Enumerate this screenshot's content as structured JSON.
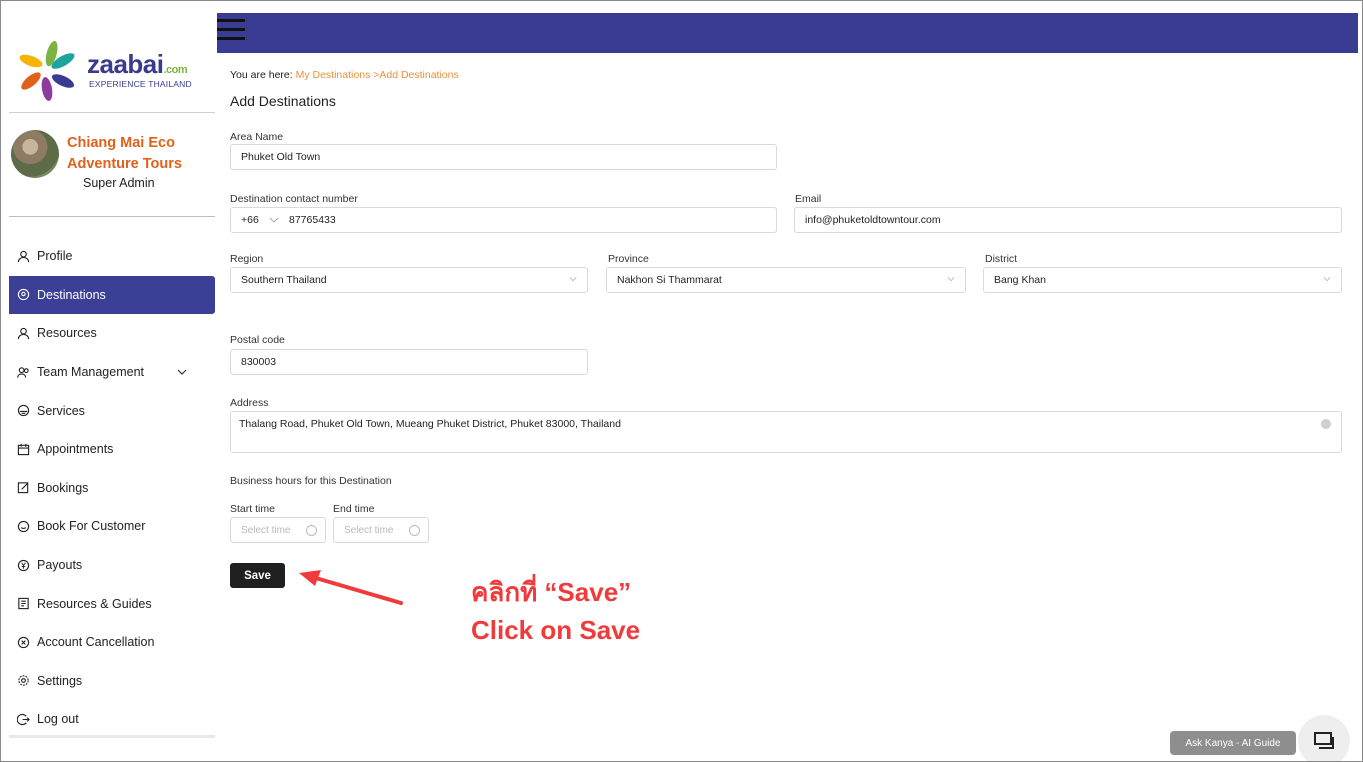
{
  "brand": {
    "name": "zaabai",
    "suffix": ".com",
    "tagline": "EXPERIENCE THAILAND"
  },
  "org": {
    "name": "Chiang Mai Eco Adventure Tours",
    "role": "Super Admin"
  },
  "nav": {
    "items": [
      {
        "label": "Profile",
        "icon": "user-icon"
      },
      {
        "label": "Destinations",
        "icon": "location-icon",
        "active": true
      },
      {
        "label": "Resources",
        "icon": "user-icon"
      },
      {
        "label": "Team Management",
        "icon": "team-icon",
        "expandable": true
      },
      {
        "label": "Services",
        "icon": "services-icon"
      },
      {
        "label": "Appointments",
        "icon": "calendar-icon"
      },
      {
        "label": "Bookings",
        "icon": "edit-icon"
      },
      {
        "label": "Book For Customer",
        "icon": "smile-icon"
      },
      {
        "label": "Payouts",
        "icon": "currency-icon"
      },
      {
        "label": "Resources & Guides",
        "icon": "document-icon"
      },
      {
        "label": "Account Cancellation",
        "icon": "close-circle-icon"
      },
      {
        "label": "Settings",
        "icon": "settings-icon"
      },
      {
        "label": "Log out",
        "icon": "logout-icon"
      }
    ]
  },
  "breadcrumb": {
    "prefix": "You are here:",
    "items": [
      "My Destinations",
      "Add Destinations"
    ],
    "separator": ">"
  },
  "page": {
    "title": "Add Destinations"
  },
  "form": {
    "area_name": {
      "label": "Area Name",
      "value": "Phuket Old Town"
    },
    "contact": {
      "label": "Destination contact number",
      "code": "+66",
      "value": "87765433"
    },
    "email": {
      "label": "Email",
      "value": "info@phuketoldtowntour.com"
    },
    "region": {
      "label": "Region",
      "value": "Southern Thailand"
    },
    "province": {
      "label": "Province",
      "value": "Nakhon Si Thammarat"
    },
    "district": {
      "label": "District",
      "value": "Bang Khan"
    },
    "postal": {
      "label": "Postal code",
      "value": "830003"
    },
    "address": {
      "label": "Address",
      "value": "Thalang Road, Phuket Old Town, Mueang Phuket District, Phuket 83000, Thailand"
    },
    "hours": {
      "label": "Business hours for this Destination",
      "start_label": "Start time",
      "end_label": "End time",
      "placeholder": "Select time"
    },
    "save_label": "Save"
  },
  "annotation": {
    "line1": "คลิกที่ “Save”",
    "line2": "Click on Save",
    "color": "#ef3b3b"
  },
  "chat": {
    "label": "Ask Kanya - AI Guide"
  },
  "colors": {
    "primary": "#3a3b93",
    "accent": "#e0611a",
    "link": "#e8913a"
  }
}
